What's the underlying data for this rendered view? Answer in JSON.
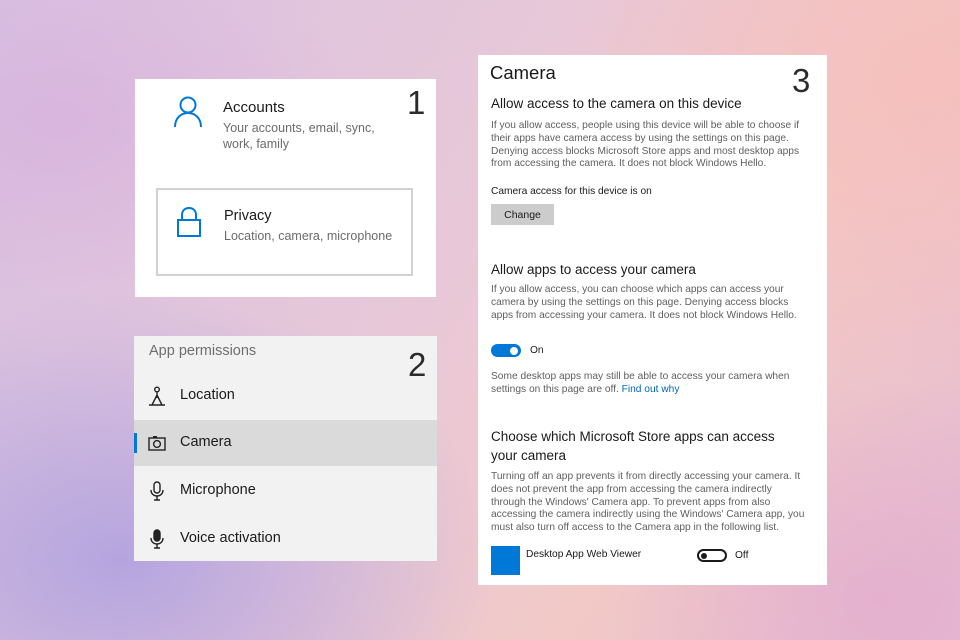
{
  "panel1": {
    "number": "1",
    "accounts": {
      "title": "Accounts",
      "description": "Your accounts, email, sync, work, family",
      "icon": "person-icon"
    },
    "privacy": {
      "title": "Privacy",
      "description": "Location, camera, microphone",
      "icon": "lock-icon"
    }
  },
  "panel2": {
    "number": "2",
    "title": "App permissions",
    "items": [
      {
        "label": "Location",
        "icon": "location-icon",
        "selected": false
      },
      {
        "label": "Camera",
        "icon": "camera-icon",
        "selected": true
      },
      {
        "label": "Microphone",
        "icon": "microphone-icon",
        "selected": false
      },
      {
        "label": "Voice activation",
        "icon": "voice-microphone-icon",
        "selected": false
      }
    ]
  },
  "panel3": {
    "number": "3",
    "title": "Camera",
    "device_section": {
      "heading": "Allow access to the camera on this device",
      "description": "If you allow access, people using this device will be able to choose if their apps have camera access by using the settings on this page. Denying access blocks Microsoft Store apps and most desktop apps from accessing the camera. It does not block Windows Hello.",
      "status": "Camera access for this device is on",
      "change_button": "Change"
    },
    "apps_section": {
      "heading": "Allow apps to access your camera",
      "description": "If you allow access, you can choose which apps can access your camera by using the settings on this page. Denying access blocks apps from accessing your camera. It does not block Windows Hello.",
      "toggle_state": "On",
      "note": "Some desktop apps may still be able to access your camera when settings on this page are off.",
      "note_link": "Find out why"
    },
    "store_section": {
      "heading": "Choose which Microsoft Store apps can access your camera",
      "description": "Turning off an app prevents it from directly accessing your camera. It does not prevent the app from accessing the camera indirectly through the Windows' Camera app. To prevent apps from also accessing the camera indirectly using the Windows' Camera app, you must also turn off access to the Camera app in the following list.",
      "apps": [
        {
          "name": "Desktop App Web Viewer",
          "toggle_state": "Off"
        }
      ]
    }
  },
  "colors": {
    "accent": "#0078d7",
    "link": "#0067b8",
    "selected_bg": "#dadada"
  }
}
